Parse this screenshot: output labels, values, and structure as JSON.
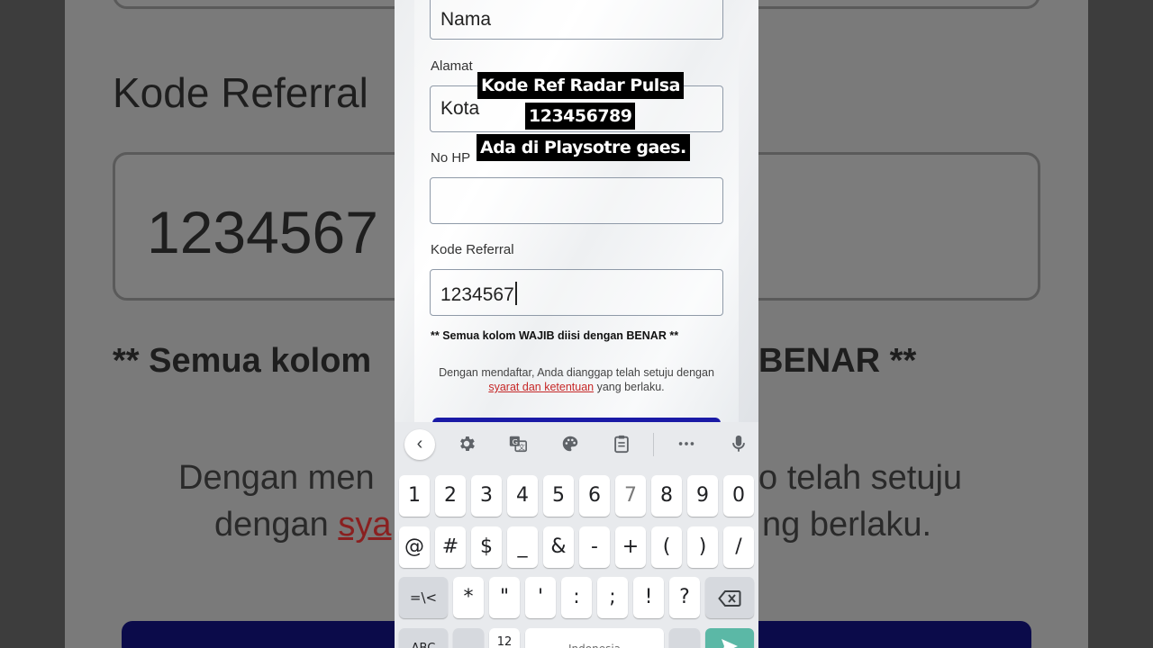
{
  "background": {
    "heading": "Kode Referral",
    "input_value": "1234567",
    "required_text_left": "** Semua kolom",
    "required_text_right": "BENAR **",
    "terms_line1_left": "Dengan men",
    "terms_line1_right": "o telah setuju",
    "terms_line2_left": "dengan ",
    "terms_line2_link": "sya",
    "terms_line2_right": "ng berlaku."
  },
  "form": {
    "nama_value": "Nama",
    "alamat_label": "Alamat",
    "alamat_value": "Kota",
    "nohp_label": "No HP",
    "nohp_value": "",
    "referral_label": "Kode Referral",
    "referral_value": "1234567",
    "required_note": "** Semua kolom WAJIB diisi dengan BENAR **",
    "terms_prefix": "Dengan mendaftar, Anda dianggap telah setuju dengan ",
    "terms_link": "syarat dan ketentuan",
    "terms_suffix": " yang berlaku."
  },
  "caption": {
    "line1": "Kode Ref Radar Pulsa",
    "line2": "123456789",
    "line3": "Ada di Playsotre gaes."
  },
  "keyboard": {
    "toolbar_icons": [
      "back-icon",
      "settings-icon",
      "translate-icon",
      "theme-palette-icon",
      "clipboard-icon",
      "more-icon",
      "mic-icon"
    ],
    "row1": [
      "1",
      "2",
      "3",
      "4",
      "5",
      "6",
      "7",
      "8",
      "9",
      "0"
    ],
    "row2": [
      "@",
      "#",
      "$",
      "_",
      "&",
      "-",
      "+",
      "(",
      ")",
      "/"
    ],
    "row3": [
      "=\\<",
      "*",
      "\"",
      "'",
      ":",
      ";",
      "!",
      "?"
    ],
    "row4_abc": "ABC",
    "row4_12": "12",
    "row4_space": "Indonesia",
    "colors": {
      "send_key": "#5bb8a6",
      "keyboard_bg": "#e8eaed"
    }
  }
}
